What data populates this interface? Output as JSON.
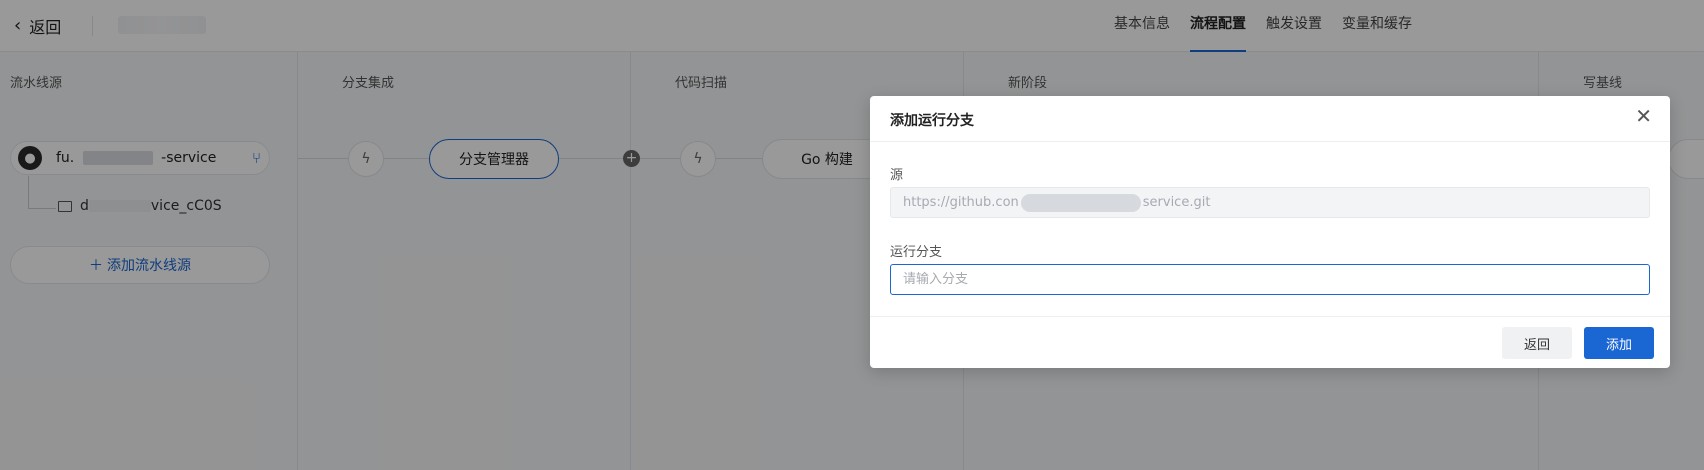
{
  "header": {
    "back_label": "返回",
    "tabs": [
      {
        "label": "基本信息"
      },
      {
        "label": "流程配置"
      },
      {
        "label": "触发设置"
      },
      {
        "label": "变量和缓存"
      }
    ]
  },
  "pipeline": {
    "columns": [
      {
        "title": "流水线源"
      },
      {
        "title": "分支集成"
      },
      {
        "title": "代码扫描"
      },
      {
        "title": "新阶段"
      },
      {
        "title": "写基线"
      }
    ],
    "source": {
      "name_prefix": "fu.",
      "name_suffix": "-service",
      "folder_prefix": "d",
      "folder_suffix": "vice_cC0S",
      "add_label": "添加流水线源"
    },
    "jobs": [
      {
        "label": "分支管理器"
      },
      {
        "label": "Go 构建"
      }
    ]
  },
  "dialog": {
    "title": "添加运行分支",
    "source_label": "源",
    "source_value_prefix": "https://github.con",
    "source_value_suffix": "service.git",
    "branch_label": "运行分支",
    "branch_placeholder": "请输入分支",
    "cancel_label": "返回",
    "confirm_label": "添加"
  },
  "colors": {
    "accent": "#1a66d2",
    "overlay": "rgba(0,0,0,0.40)"
  }
}
